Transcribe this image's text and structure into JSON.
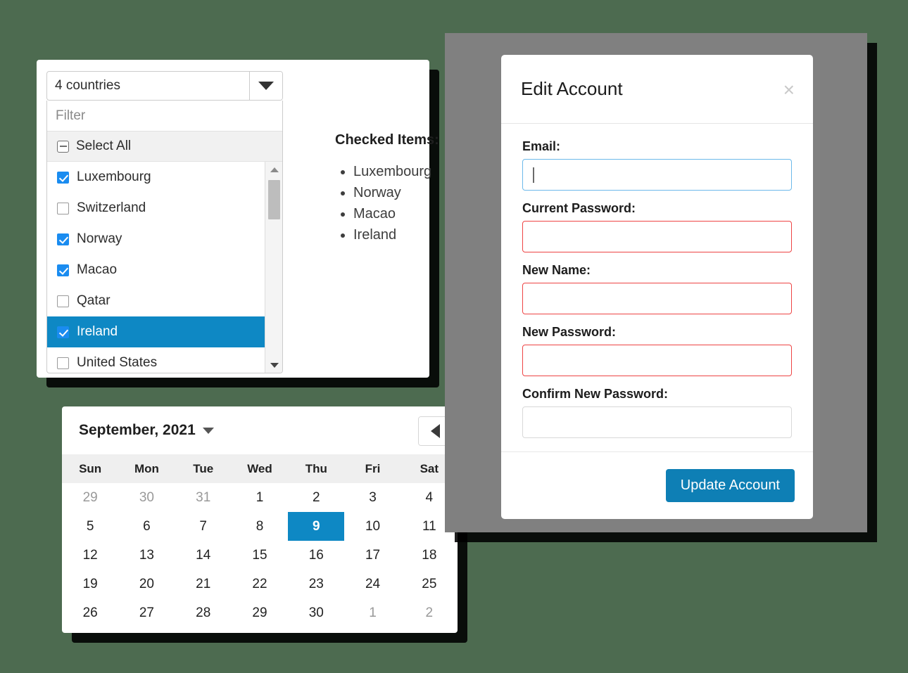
{
  "multiselect": {
    "toggle_label": "4 countries",
    "caret_icon": "chevron-down-icon",
    "filter_placeholder": "Filter",
    "select_all_label": "Select All",
    "select_all_state": "indeterminate",
    "items": [
      {
        "label": "Luxembourg",
        "checked": true,
        "highlighted": false
      },
      {
        "label": "Switzerland",
        "checked": false,
        "highlighted": false
      },
      {
        "label": "Norway",
        "checked": true,
        "highlighted": false
      },
      {
        "label": "Macao",
        "checked": true,
        "highlighted": false
      },
      {
        "label": "Qatar",
        "checked": false,
        "highlighted": false
      },
      {
        "label": "Ireland",
        "checked": true,
        "highlighted": true
      },
      {
        "label": "United States",
        "checked": false,
        "highlighted": false
      }
    ],
    "scrollbar": {
      "up_icon": "triangle-up-icon",
      "down_icon": "triangle-down-icon"
    }
  },
  "checked_items": {
    "title": "Checked Items:",
    "items": [
      "Luxembourg",
      "Norway",
      "Macao",
      "Ireland"
    ]
  },
  "calendar": {
    "title": "September, 2021",
    "title_caret_icon": "caret-down-icon",
    "nav": [
      {
        "name": "prev-month-button",
        "icon": "triangle-left-icon"
      },
      {
        "name": "today-button",
        "icon": "dot-icon"
      },
      {
        "name": "next-month-button",
        "icon": "triangle-right-icon"
      }
    ],
    "weekdays": [
      "Sun",
      "Mon",
      "Tue",
      "Wed",
      "Thu",
      "Fri",
      "Sat"
    ],
    "weeks": [
      [
        {
          "d": "29",
          "muted": true,
          "selected": false
        },
        {
          "d": "30",
          "muted": true,
          "selected": false
        },
        {
          "d": "31",
          "muted": true,
          "selected": false
        },
        {
          "d": "1",
          "muted": false,
          "selected": false
        },
        {
          "d": "2",
          "muted": false,
          "selected": false
        },
        {
          "d": "3",
          "muted": false,
          "selected": false
        },
        {
          "d": "4",
          "muted": false,
          "selected": false
        }
      ],
      [
        {
          "d": "5",
          "muted": false,
          "selected": false
        },
        {
          "d": "6",
          "muted": false,
          "selected": false
        },
        {
          "d": "7",
          "muted": false,
          "selected": false
        },
        {
          "d": "8",
          "muted": false,
          "selected": false
        },
        {
          "d": "9",
          "muted": false,
          "selected": true
        },
        {
          "d": "10",
          "muted": false,
          "selected": false
        },
        {
          "d": "11",
          "muted": false,
          "selected": false
        }
      ],
      [
        {
          "d": "12",
          "muted": false,
          "selected": false
        },
        {
          "d": "13",
          "muted": false,
          "selected": false
        },
        {
          "d": "14",
          "muted": false,
          "selected": false
        },
        {
          "d": "15",
          "muted": false,
          "selected": false
        },
        {
          "d": "16",
          "muted": false,
          "selected": false
        },
        {
          "d": "17",
          "muted": false,
          "selected": false
        },
        {
          "d": "18",
          "muted": false,
          "selected": false
        }
      ],
      [
        {
          "d": "19",
          "muted": false,
          "selected": false
        },
        {
          "d": "20",
          "muted": false,
          "selected": false
        },
        {
          "d": "21",
          "muted": false,
          "selected": false
        },
        {
          "d": "22",
          "muted": false,
          "selected": false
        },
        {
          "d": "23",
          "muted": false,
          "selected": false
        },
        {
          "d": "24",
          "muted": false,
          "selected": false
        },
        {
          "d": "25",
          "muted": false,
          "selected": false
        }
      ],
      [
        {
          "d": "26",
          "muted": false,
          "selected": false
        },
        {
          "d": "27",
          "muted": false,
          "selected": false
        },
        {
          "d": "28",
          "muted": false,
          "selected": false
        },
        {
          "d": "29",
          "muted": false,
          "selected": false
        },
        {
          "d": "30",
          "muted": false,
          "selected": false
        },
        {
          "d": "1",
          "muted": true,
          "selected": false
        },
        {
          "d": "2",
          "muted": true,
          "selected": false
        }
      ]
    ]
  },
  "modal": {
    "title": "Edit Account",
    "close_label": "×",
    "close_icon": "close-icon",
    "fields": [
      {
        "label": "Email:",
        "value": "",
        "state": "focused"
      },
      {
        "label": "Current Password:",
        "value": "",
        "state": "error"
      },
      {
        "label": "New Name:",
        "value": "",
        "state": "error"
      },
      {
        "label": "New Password:",
        "value": "",
        "state": "error"
      },
      {
        "label": "Confirm New Password:",
        "value": "",
        "state": "normal"
      }
    ],
    "submit_label": "Update Account"
  },
  "colors": {
    "background": "#4d6b50",
    "overlay": "#808080",
    "accent_blue": "#0e88c4",
    "button_blue": "#0e7fb5",
    "checkbox_blue": "#1a8cf0",
    "error_red": "#ee4444",
    "focus_blue": "#6cb9ea"
  }
}
